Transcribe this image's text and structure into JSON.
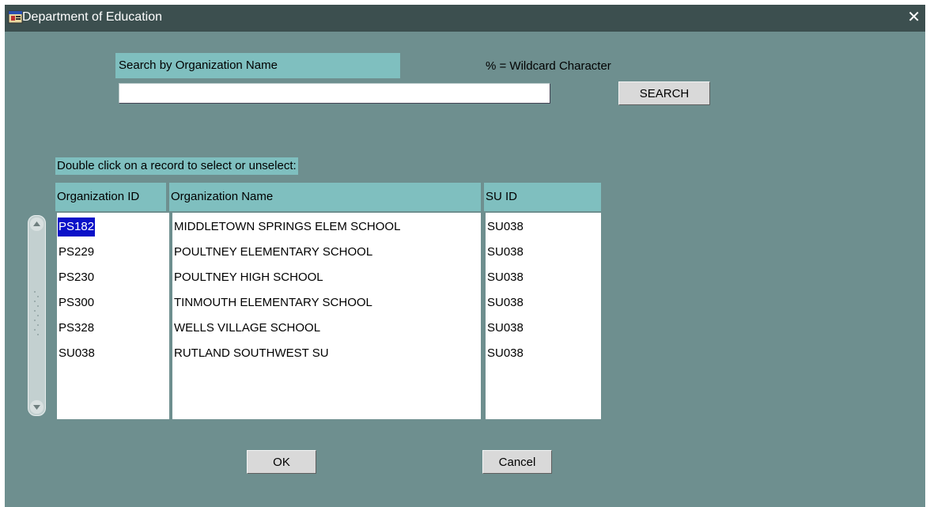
{
  "window": {
    "title": "Department of Education",
    "close_glyph": "✕",
    "icon": "app-window-icon"
  },
  "search": {
    "label": "Search by Organization Name",
    "wildcard_note": "% = Wildcard Character",
    "value": "",
    "placeholder": "",
    "button_label": "SEARCH"
  },
  "instructions": "Double click on a record to select or unselect:",
  "table": {
    "headers": [
      "Organization ID",
      "Organization Name",
      "SU ID"
    ],
    "rows": [
      [
        "PS182",
        "MIDDLETOWN SPRINGS ELEM SCHOOL",
        "SU038"
      ],
      [
        "PS229",
        "POULTNEY ELEMENTARY SCHOOL",
        "SU038"
      ],
      [
        "PS230",
        "POULTNEY HIGH SCHOOL",
        "SU038"
      ],
      [
        "PS300",
        "TINMOUTH ELEMENTARY SCHOOL",
        "SU038"
      ],
      [
        "PS328",
        "WELLS VILLAGE SCHOOL",
        "SU038"
      ],
      [
        "SU038",
        "RUTLAND SOUTHWEST SU",
        "SU038"
      ]
    ],
    "selected_row": 0
  },
  "buttons": {
    "ok_label": "OK",
    "cancel_label": "Cancel"
  },
  "colors": {
    "background": "#6e8f8f",
    "title_bar": "#3c4f4f",
    "header_fill": "#7fbfbf",
    "selection": "#0a10c8"
  }
}
